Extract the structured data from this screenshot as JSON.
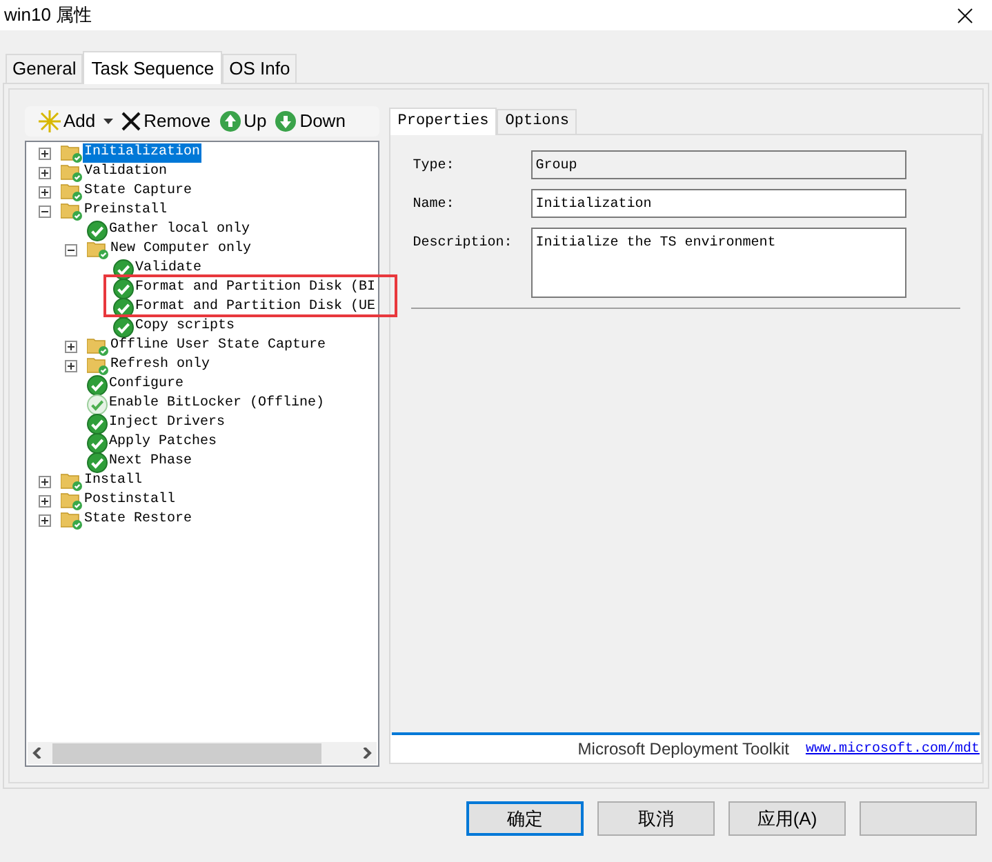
{
  "window": {
    "title": "win10 属性"
  },
  "tabs": [
    {
      "label": "General",
      "selected": false
    },
    {
      "label": "Task Sequence",
      "selected": true
    },
    {
      "label": "OS Info",
      "selected": false
    }
  ],
  "toolbar": [
    {
      "label": "Add",
      "kind": "add"
    },
    {
      "label": "Remove",
      "kind": "remove"
    },
    {
      "label": "Up",
      "kind": "up"
    },
    {
      "label": "Down",
      "kind": "down"
    }
  ],
  "tree": [
    {
      "label": "Initialization",
      "kind": "group",
      "expanded": false,
      "selected": true
    },
    {
      "label": "Validation",
      "kind": "group",
      "expanded": false,
      "selected": false
    },
    {
      "label": "State Capture",
      "kind": "group",
      "expanded": false,
      "selected": false
    },
    {
      "label": "Preinstall",
      "kind": "group",
      "expanded": true,
      "selected": false,
      "children": [
        {
          "label": "Gather local only",
          "kind": "step",
          "disabled": false,
          "selected": false
        },
        {
          "label": "New Computer only",
          "kind": "group",
          "expanded": true,
          "selected": false,
          "children": [
            {
              "label": "Validate",
              "kind": "step",
              "disabled": false,
              "selected": false
            },
            {
              "label": "Format and Partition Disk (BI",
              "kind": "step",
              "disabled": false,
              "selected": false
            },
            {
              "label": "Format and Partition Disk (UE",
              "kind": "step",
              "disabled": false,
              "selected": false
            },
            {
              "label": "Copy scripts",
              "kind": "step",
              "disabled": false,
              "selected": false
            }
          ]
        },
        {
          "label": "Offline User State Capture",
          "kind": "group",
          "expanded": false,
          "selected": false
        },
        {
          "label": "Refresh only",
          "kind": "group",
          "expanded": false,
          "selected": false
        },
        {
          "label": "Configure",
          "kind": "step",
          "disabled": false,
          "selected": false
        },
        {
          "label": "Enable BitLocker (Offline)",
          "kind": "step",
          "disabled": true,
          "selected": false
        },
        {
          "label": "Inject Drivers",
          "kind": "step",
          "disabled": false,
          "selected": false
        },
        {
          "label": "Apply Patches",
          "kind": "step",
          "disabled": false,
          "selected": false
        },
        {
          "label": "Next Phase",
          "kind": "step",
          "disabled": false,
          "selected": false
        }
      ]
    },
    {
      "label": "Install",
      "kind": "group",
      "expanded": false,
      "selected": false
    },
    {
      "label": "Postinstall",
      "kind": "group",
      "expanded": false,
      "selected": false
    },
    {
      "label": "State Restore",
      "kind": "group",
      "expanded": false,
      "selected": false
    }
  ],
  "detail_tabs": [
    {
      "label": "Properties",
      "selected": true
    },
    {
      "label": "Options",
      "selected": false
    }
  ],
  "fields": [
    {
      "label": "Type:",
      "value": "Group",
      "kind": "line",
      "disabled": true
    },
    {
      "label": "Name:",
      "value": "Initialization",
      "kind": "line",
      "disabled": false
    },
    {
      "label": "Description:",
      "value": "Initialize the TS environment",
      "kind": "multiline",
      "disabled": false
    }
  ],
  "footer": {
    "text": "Microsoft Deployment Toolkit",
    "link": "www.microsoft.com/mdt"
  },
  "buttons": [
    {
      "label": "确定",
      "default": true
    },
    {
      "label": "取消",
      "default": false
    },
    {
      "label": "应用(A)",
      "default": false
    },
    {
      "default": false
    }
  ]
}
